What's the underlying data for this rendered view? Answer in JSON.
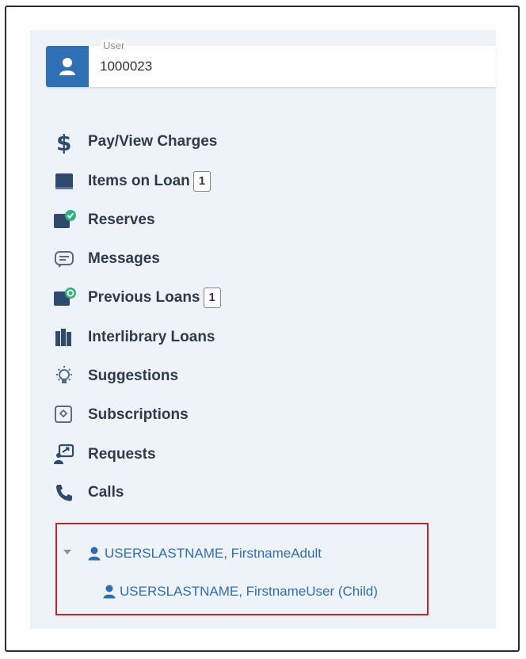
{
  "user": {
    "label": "User",
    "value": "1000023"
  },
  "menu": [
    {
      "label": "Pay/View Charges",
      "icon": "dollar-icon"
    },
    {
      "label": "Items on Loan",
      "icon": "book-icon",
      "count": "1"
    },
    {
      "label": "Reserves",
      "icon": "reserve-book-icon"
    },
    {
      "label": "Messages",
      "icon": "message-icon"
    },
    {
      "label": "Previous Loans",
      "icon": "previous-loans-icon",
      "count": "1"
    },
    {
      "label": "Interlibrary Loans",
      "icon": "books-icon"
    },
    {
      "label": "Suggestions",
      "icon": "lightbulb-icon"
    },
    {
      "label": "Subscriptions",
      "icon": "subscription-icon"
    },
    {
      "label": "Requests",
      "icon": "request-icon"
    },
    {
      "label": "Calls",
      "icon": "phone-icon"
    }
  ],
  "accounts": {
    "parent": "USERSLASTNAME, FirstnameAdult",
    "child": "USERSLASTNAME, FirstnameUser (Child)"
  },
  "colors": {
    "accent": "#2f6fb3",
    "link": "#2d6fb0",
    "icon": "#2f4a6e",
    "green": "#2fb37a",
    "highlight": "#c0272d"
  }
}
